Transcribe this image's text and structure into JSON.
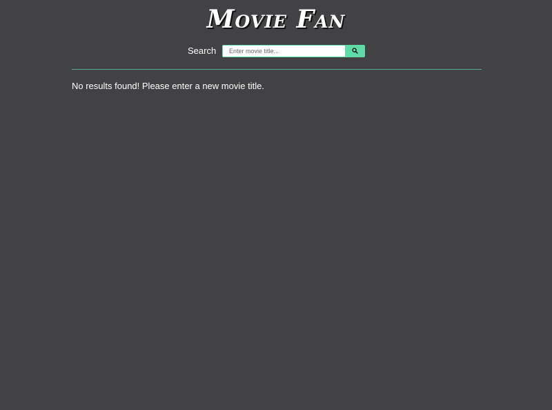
{
  "header": {
    "title": "Movie Fan"
  },
  "search": {
    "label": "Search",
    "value": "",
    "placeholder": "Enter movie title...",
    "button_icon": "search-icon"
  },
  "results": {
    "message": "No results found! Please enter a new movie title."
  },
  "colors": {
    "background": "#424144",
    "accent": "#5edba6",
    "divider": "#5aa68a",
    "text": "#ffffff"
  }
}
